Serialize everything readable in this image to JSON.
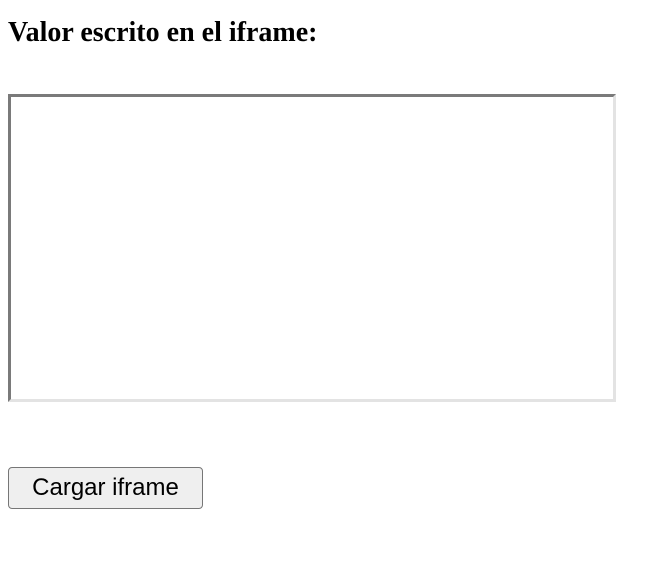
{
  "heading": {
    "text": "Valor escrito en el iframe:"
  },
  "iframe": {
    "content": ""
  },
  "button": {
    "label": "Cargar iframe"
  },
  "colors": {
    "background": "#ffffff",
    "iframe_border_dark": "#7a7a7a",
    "iframe_border_light": "#e3e3e3",
    "button_background": "#efefef",
    "button_border": "#767676"
  }
}
